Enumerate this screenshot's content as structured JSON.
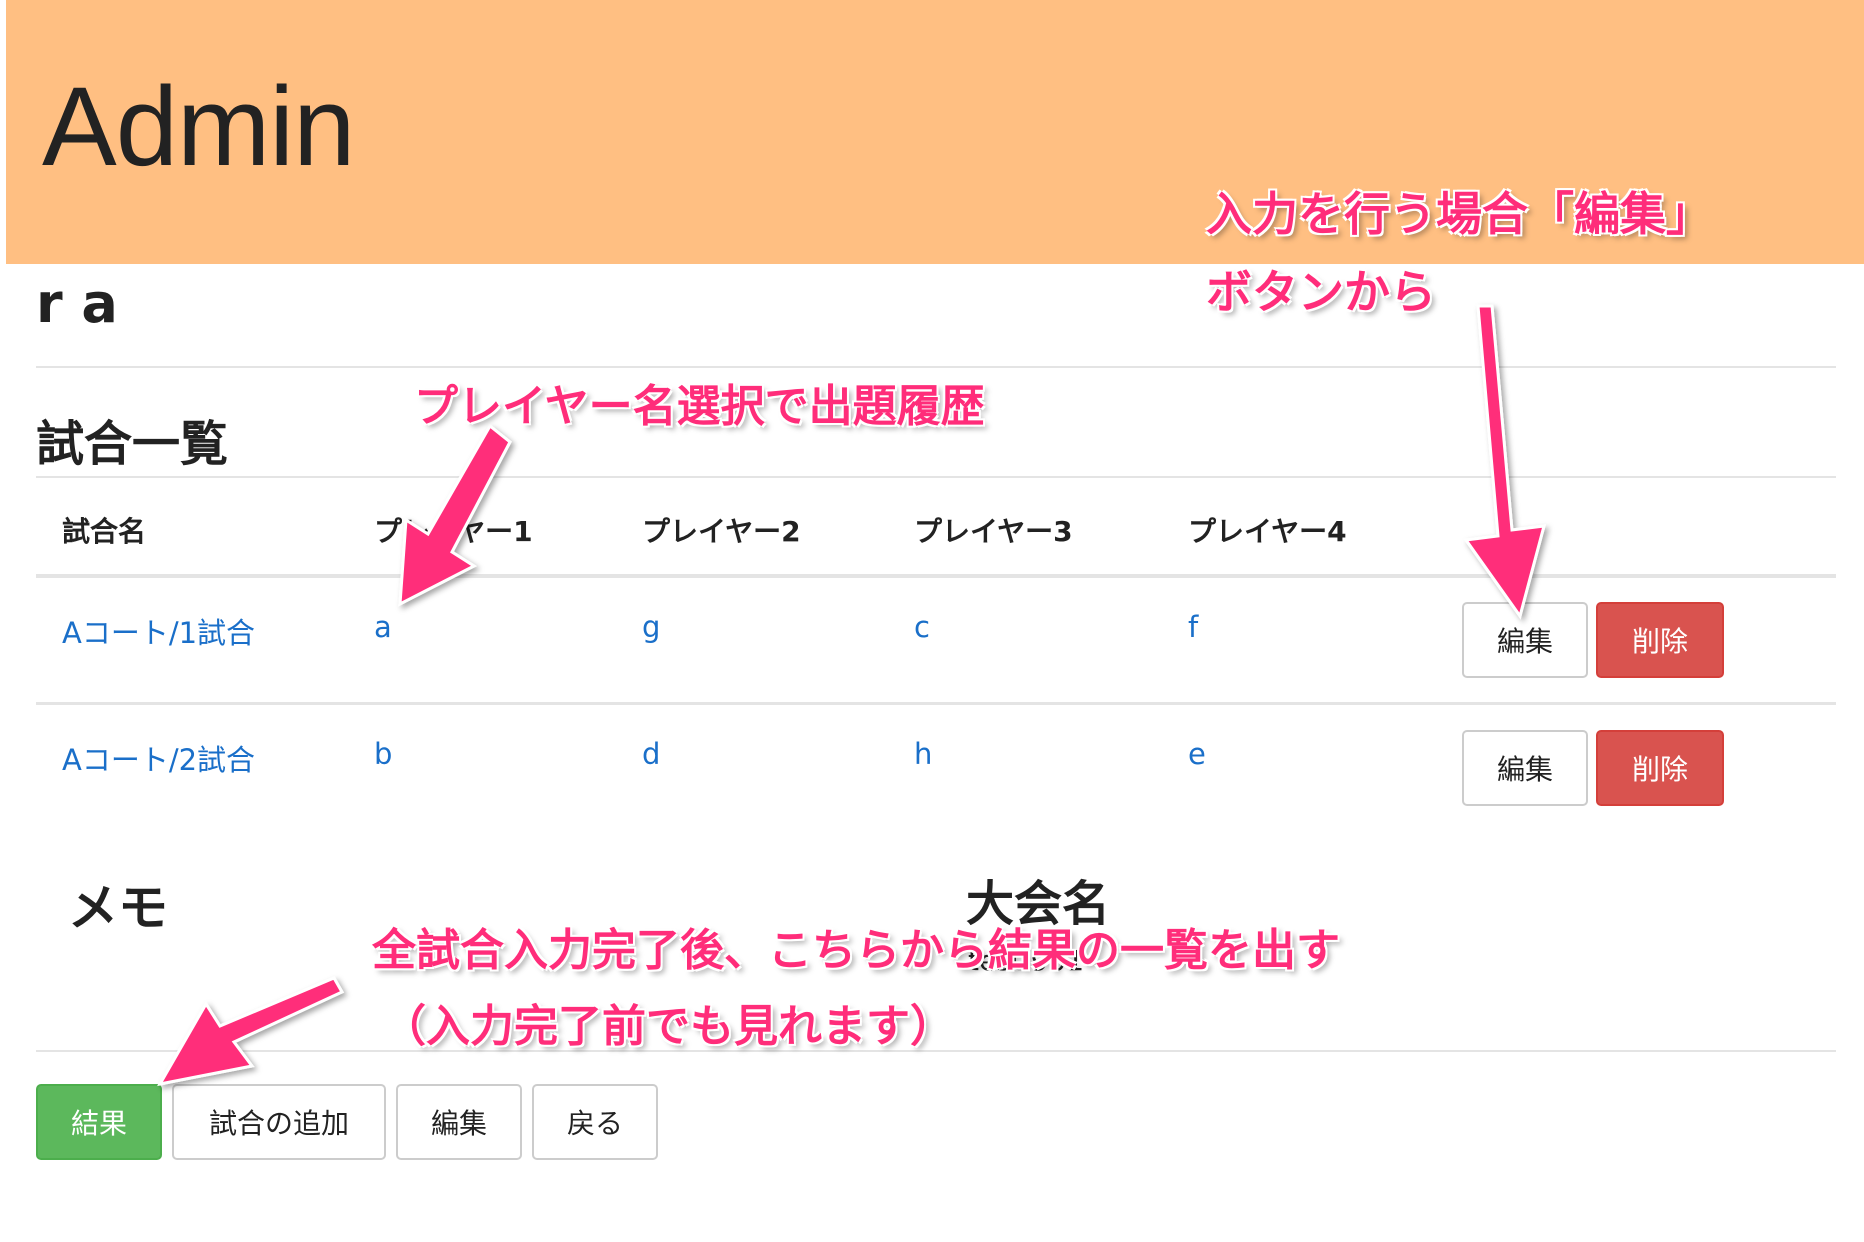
{
  "header": {
    "title": "Admin",
    "bg": "#ffbf82"
  },
  "tournament": {
    "name": "r a"
  },
  "matches": {
    "title": "試合一覧",
    "columns": [
      "試合名",
      "プレイヤー1",
      "プレイヤー2",
      "プレイヤー3",
      "プレイヤー4"
    ],
    "rows": [
      {
        "name": "Aコート/1試合",
        "p1": "a",
        "p2": "g",
        "p3": "c",
        "p4": "f",
        "edit": "編集",
        "delete": "削除"
      },
      {
        "name": "Aコート/2試合",
        "p1": "b",
        "p2": "d",
        "p3": "h",
        "p4": "e",
        "edit": "編集",
        "delete": "削除"
      }
    ]
  },
  "memo": {
    "title": "メモ"
  },
  "tournament_info": {
    "label": "大会名",
    "value": "test 901"
  },
  "footer": {
    "result": "結果",
    "add_match": "試合の追加",
    "edit": "編集",
    "back": "戻る"
  },
  "annotations": {
    "edit_hint_line1": "入力を行う場合「編集」",
    "edit_hint_line2": "ボタンから",
    "player_hint": "プレイヤー名選択で出題履歴",
    "result_hint_line1": "全試合入力完了後、こちらから結果の一覧を出す",
    "result_hint_line2": "（入力完了前でも見れます）",
    "color": "#ff2d7a"
  },
  "colors": {
    "link": "#1a6fc9",
    "danger": "#d9534f",
    "success": "#5cb85c"
  }
}
